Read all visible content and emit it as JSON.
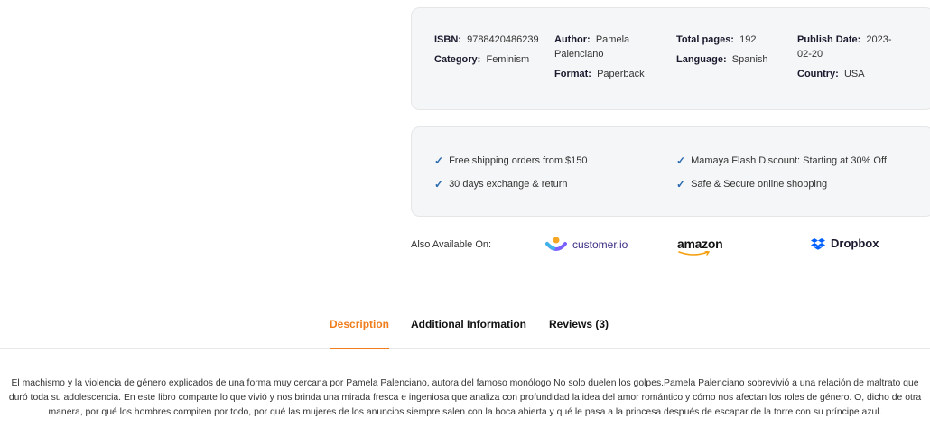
{
  "meta": {
    "isbn_label": "ISBN:",
    "isbn": "9788420486239",
    "category_label": "Category:",
    "category": "Feminism",
    "author_label": "Author:",
    "author_line1": "Pamela",
    "author_line2": "Palenciano",
    "format_label": "Format:",
    "format": "Paperback",
    "pages_label": "Total pages:",
    "pages": "192",
    "language_label": "Language:",
    "language": "Spanish",
    "date_label": "Publish Date:",
    "date_line1": "2023-",
    "date_line2": "02-20",
    "country_label": "Country:",
    "country": "USA"
  },
  "features": [
    {
      "text": "Free shipping orders from $150",
      "icon": "check-icon"
    },
    {
      "text": "Mamaya Flash Discount: Starting at 30% Off",
      "icon": "check-icon"
    },
    {
      "text": "30 days exchange & return",
      "icon": "check-icon"
    },
    {
      "text": "Safe & Secure online shopping",
      "icon": "check-icon"
    }
  ],
  "availability": {
    "label": "Also Available On:",
    "brands": [
      {
        "name": "customer.io",
        "icon": "customerio-logo-icon"
      },
      {
        "name": "amazon",
        "icon": "amazon-logo-icon"
      },
      {
        "name": "Dropbox",
        "icon": "dropbox-logo-icon"
      }
    ]
  },
  "tabs": [
    {
      "label": "Description",
      "active": true
    },
    {
      "label": "Additional Information",
      "active": false
    },
    {
      "label": "Reviews (3)",
      "active": false
    }
  ],
  "description": "El machismo y la violencia de género explicados de una forma muy cercana por Pamela Palenciano, autora del famoso monólogo No solo duelen los golpes.Pamela Palenciano sobrevivió a una relación de maltrato que duró toda su adolescencia. En este libro comparte lo que vivió y nos brinda una mirada fresca e ingeniosa que analiza con profundidad la idea del amor romántico y cómo nos afectan los roles de género. O, dicho de otra manera, por qué los hombres compiten por todo, por qué las mujeres de los anuncios siempre salen con la boca abierta y qué le pasa a la princesa después de escapar de la torre con su príncipe azul.",
  "colors": {
    "accent": "#f07c1b",
    "check": "#2b6cb0",
    "card_bg": "#f5f6f7"
  }
}
